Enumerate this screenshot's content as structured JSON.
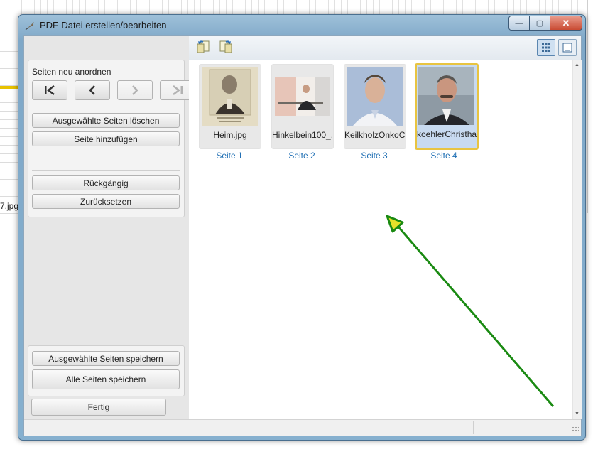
{
  "window": {
    "title": "PDF-Datei erstellen/bearbeiten"
  },
  "caption_buttons": {
    "minimize": "—",
    "maximize": "▢",
    "close": "✕"
  },
  "background": {
    "file_label": "7.jpg"
  },
  "left_panel": {
    "reorder_heading": "Seiten neu anordnen",
    "nav": {
      "first": "K",
      "prev": "‹",
      "next": "›",
      "last": "›I"
    },
    "delete_selected": "Ausgewählte Seiten löschen",
    "add_page": "Seite hinzufügen",
    "undo": "Rückgängig",
    "reset": "Zurücksetzen",
    "save_selected": "Ausgewählte Seiten speichern",
    "save_all": "Alle Seiten speichern",
    "done": "Fertig"
  },
  "pages": [
    {
      "filename": "Heim.jpg",
      "label": "Seite 1"
    },
    {
      "filename": "Hinkelbein100_...",
      "label": "Seite 2"
    },
    {
      "filename": "KeilkholzOnkoC...",
      "label": "Seite 3"
    },
    {
      "filename": "koehlerChristha...",
      "label": "Seite 4",
      "selected": true
    }
  ],
  "colors": {
    "annotation_arrow": "#1a8a12",
    "selection_border": "#e8c441",
    "page_label": "#1f6fb4"
  }
}
